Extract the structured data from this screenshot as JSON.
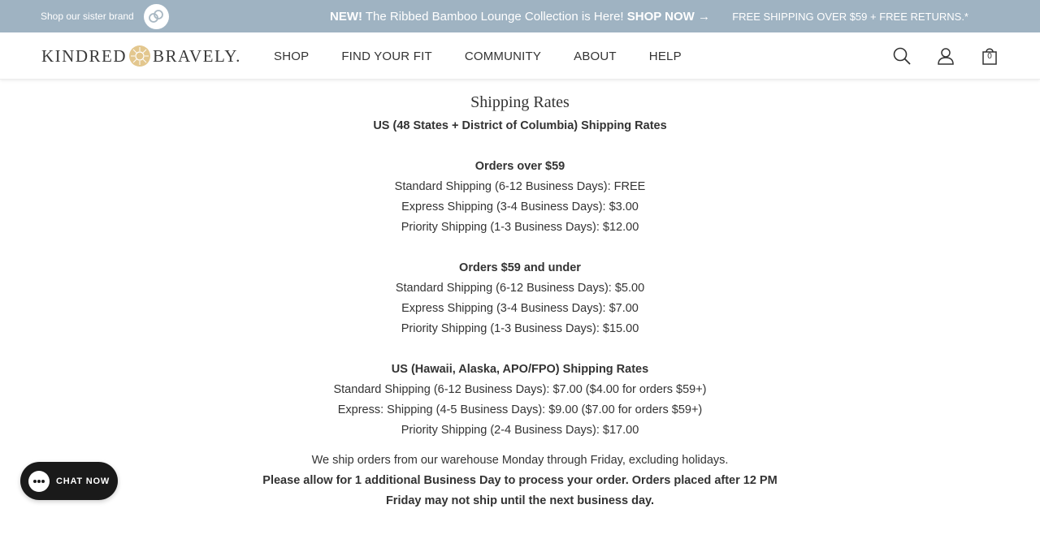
{
  "announcement": {
    "sister_text": "Shop our sister brand",
    "promo_new": "NEW!",
    "promo_text": " The Ribbed Bamboo Lounge Collection is Here! ",
    "promo_cta": "SHOP NOW →",
    "shipping_text": "FREE SHIPPING OVER $59 + FREE RETURNS.*",
    "bg_color": "#9fb3c2"
  },
  "header": {
    "logo_left": "KINDRED",
    "logo_right": "BRAVELY.",
    "nav": [
      "SHOP",
      "FIND YOUR FIT",
      "COMMUNITY",
      "ABOUT",
      "HELP"
    ],
    "icons": [
      "search-icon",
      "account-icon",
      "cart-icon"
    ],
    "cart_count": "0"
  },
  "content": {
    "title": "Shipping Rates",
    "us48_heading": "US (48 States + District of Columbia) Shipping Rates",
    "over59_heading": "Orders over $59",
    "over59_lines": [
      "Standard Shipping (6-12 Business Days): FREE",
      "Express Shipping (3-4 Business Days): $3.00",
      "Priority Shipping (1-3 Business Days): $12.00"
    ],
    "under59_heading": "Orders $59 and under",
    "under59_lines": [
      "Standard Shipping (6-12 Business Days): $5.00",
      "Express Shipping (3-4 Business Days): $7.00",
      "Priority Shipping (1-3 Business Days): $15.00"
    ],
    "hawaii_heading": "US (Hawaii, Alaska, APO/FPO) Shipping Rates",
    "hawaii_lines": [
      "Standard Shipping (6-12 Business Days): $7.00 ($4.00 for orders $59+)",
      "Express: Shipping (4-5 Business Days): $9.00 ($7.00 for orders $59+)",
      "Priority Shipping (2-4 Business Days): $17.00"
    ],
    "ship_note": "We ship orders from our warehouse Monday through Friday, excluding holidays.",
    "process_note_1": "Please allow for 1 additional Business Day to process your order. Orders placed after 12 PM",
    "process_note_2": "Friday may not ship until the next business day."
  },
  "chat": {
    "label": "CHAT NOW"
  }
}
